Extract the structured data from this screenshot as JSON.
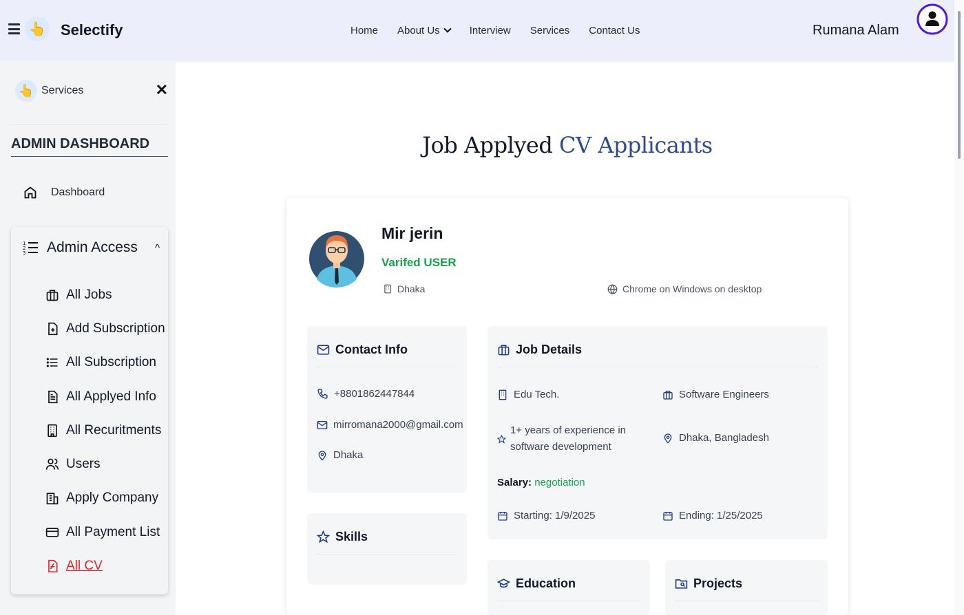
{
  "navbar": {
    "brand": "Selectify",
    "links": [
      "Home",
      "About Us",
      "Interview",
      "Services",
      "Contact Us"
    ],
    "user_name": "Rumana Alam"
  },
  "sidebar": {
    "top_label": "Services",
    "section_title": "ADMIN DASHBOARD",
    "dashboard_label": "Dashboard",
    "admin_access_label": "Admin Access",
    "items": [
      {
        "label": "All Jobs",
        "icon": "briefcase-icon"
      },
      {
        "label": "Add Subscription",
        "icon": "file-plus-icon"
      },
      {
        "label": "All Subscription",
        "icon": "list-icon"
      },
      {
        "label": "All Applyed Info",
        "icon": "file-text-icon"
      },
      {
        "label": "All Recuritments",
        "icon": "building-icon"
      },
      {
        "label": "Users",
        "icon": "users-icon"
      },
      {
        "label": "Apply Company",
        "icon": "company-icon"
      },
      {
        "label": "All Payment List",
        "icon": "credit-card-icon"
      },
      {
        "label": "All CV",
        "icon": "file-pdf-icon",
        "active": true
      }
    ]
  },
  "main": {
    "title_part1": "Job Applyed",
    "title_part2": "CV Applicants",
    "profile": {
      "name": "Mir jerin",
      "status": "Varifed USER",
      "location": "Dhaka",
      "browser": "Chrome on Windows on desktop"
    },
    "contact": {
      "title": "Contact Info",
      "phone": "+8801862447844",
      "email": "mirromana2000@gmail.com",
      "address": "Dhaka"
    },
    "skills": {
      "title": "Skills"
    },
    "job": {
      "title": "Job Details",
      "company": "Edu Tech.",
      "position": "Software Engineers",
      "experience_line1": "1+ years of experience in",
      "experience_line2": "software development",
      "location": "Dhaka, Bangladesh",
      "salary_label": "Salary:",
      "salary_value": "negotiation",
      "starting": "Starting: 1/9/2025",
      "ending": "Ending: 1/25/2025"
    },
    "education": {
      "title": "Education"
    },
    "projects": {
      "title": "Projects"
    }
  },
  "colors": {
    "navbar_bg": "#eceefb",
    "accent_blue": "#2f4b8a",
    "verified_green": "#16a34a",
    "active_red": "#dc2626",
    "avatar_ring": "#4f1ed6"
  }
}
